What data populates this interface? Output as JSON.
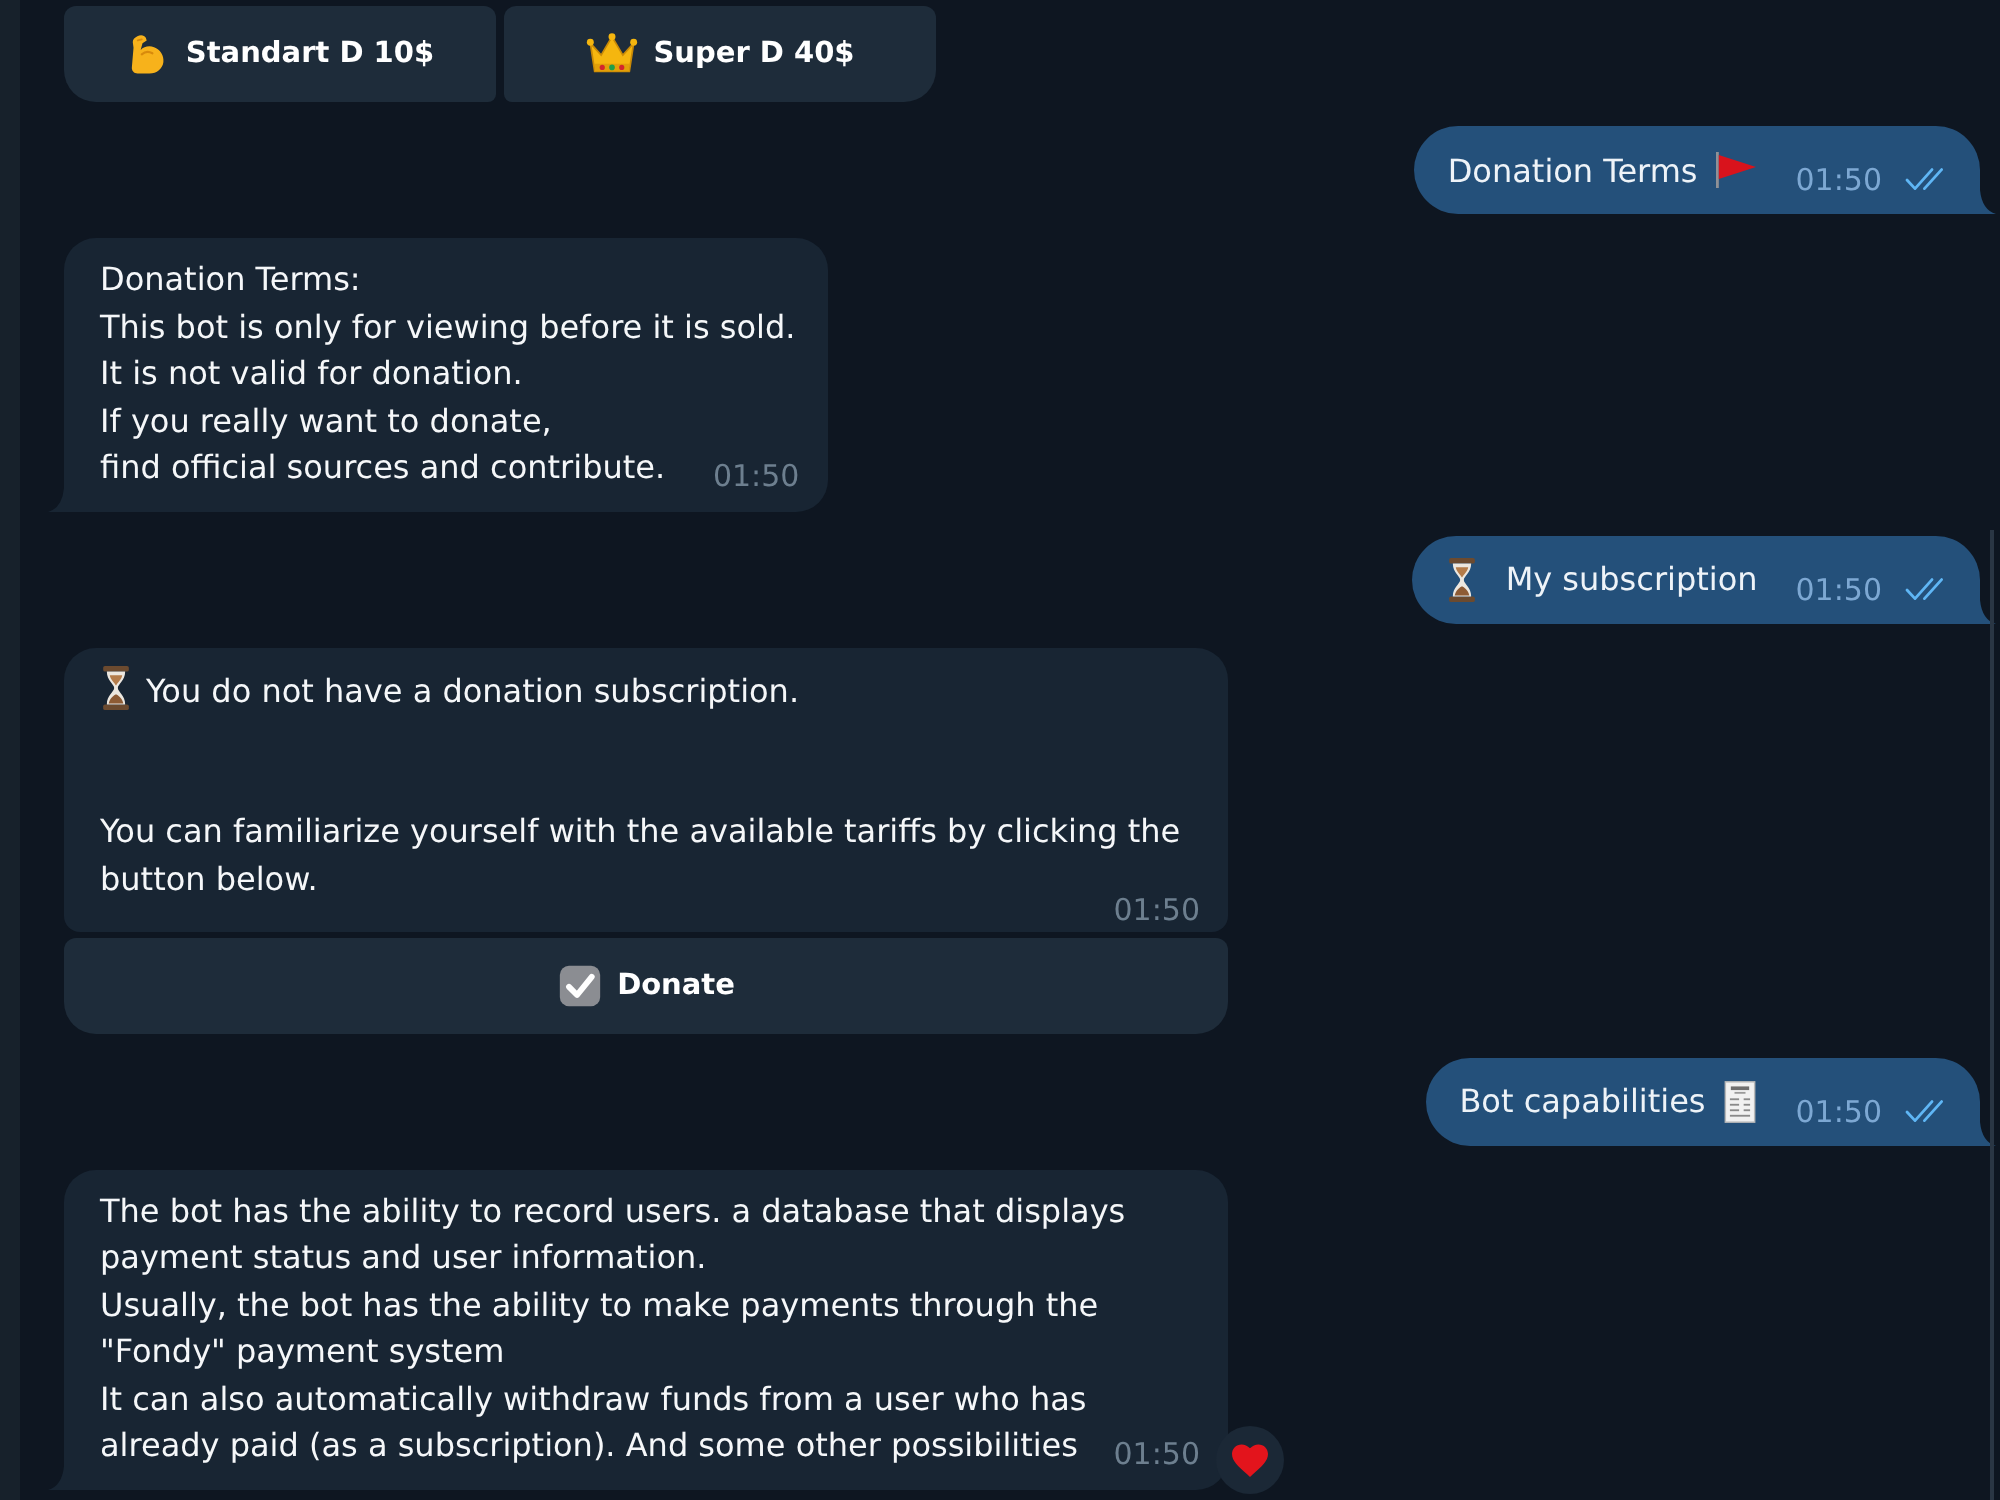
{
  "keyboard": {
    "buttons": [
      {
        "label": "Standart D 10$"
      },
      {
        "label": "Super D 40$"
      }
    ]
  },
  "messages": [
    {
      "kind": "outgoing",
      "text": "Donation Terms",
      "time": "01:50",
      "read": true,
      "reacted": false
    },
    {
      "kind": "incoming",
      "text": "Donation Terms:\nThis bot is only for viewing before it is sold.\nIt is not valid for donation.\nIf you really want to donate,\nfind official sources and contribute.",
      "time": "01:50",
      "reacted": false
    },
    {
      "kind": "outgoing",
      "text": "My subscription",
      "time": "01:50",
      "read": true,
      "reacted": false
    },
    {
      "kind": "incoming",
      "text": "You do not have a donation subscription.\n\n\nYou can familiarize yourself with the available tariffs by clicking the button below.",
      "time": "01:50",
      "reacted": false,
      "buttons": [
        {
          "label": "Donate"
        }
      ]
    },
    {
      "kind": "outgoing",
      "text": "Bot capabilities",
      "time": "01:50",
      "read": true,
      "reacted": false
    },
    {
      "kind": "incoming",
      "text": "The bot has the ability to record users. a database that displays payment status and user information.\nUsually, the bot has the ability to make payments through the \"Fondy\" payment system\nIt can also automatically withdraw funds from a user who has already paid (as a subscription). And some other possibilities",
      "time": "01:50",
      "reacted": true
    }
  ]
}
